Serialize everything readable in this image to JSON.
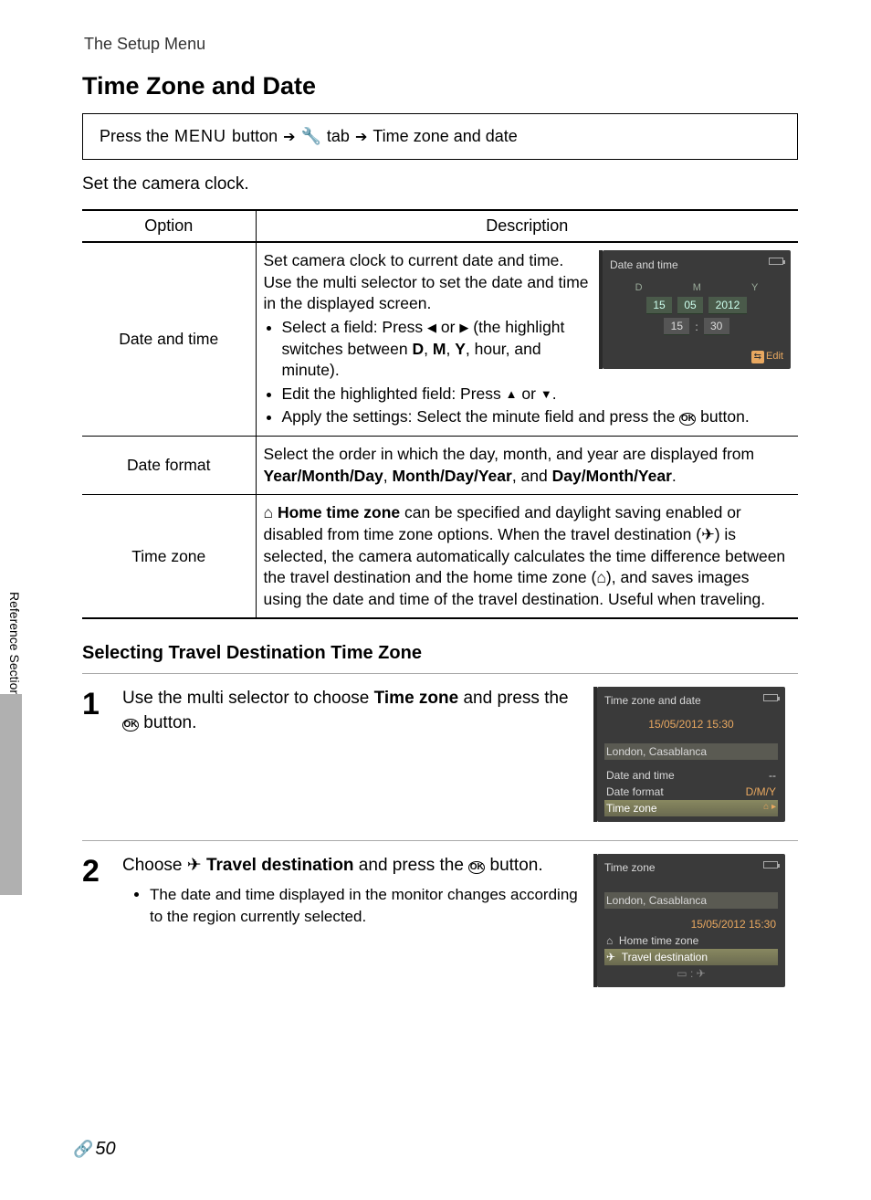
{
  "header": "The Setup Menu",
  "title": "Time Zone and Date",
  "nav": {
    "prefix": "Press the",
    "menu_word": "MENU",
    "button_word": "button",
    "tab_word": "tab",
    "dest": "Time zone and date"
  },
  "intro": "Set the camera clock.",
  "table": {
    "head_option": "Option",
    "head_desc": "Description",
    "rows": [
      {
        "option": "Date and time",
        "desc_pre": "Set camera clock to current date and time.\nUse the multi selector to set the date and time in the displayed screen.",
        "bullet1_a": "Select a field: Press ",
        "bullet1_b": " or ",
        "bullet1_c": " (the highlight switches between ",
        "bullet1_d": ", hour, and minute).",
        "bullet2_a": "Edit the highlighted field: Press ",
        "bullet2_b": " or ",
        "bullet2_c": ".",
        "bullet3_a": "Apply the settings: Select the minute field and press the ",
        "bullet3_b": " button.",
        "b_D": "D",
        "b_M": "M",
        "b_Y": "Y"
      },
      {
        "option": "Date format",
        "desc_a": "Select the order in which the day, month, and year are displayed from ",
        "b1": "Year/Month/Day",
        "s1": ", ",
        "b2": "Month/Day/Year",
        "s2": ", and ",
        "b3": "Day/Month/Year",
        "s3": "."
      },
      {
        "option": "Time zone",
        "b_home": "Home time zone",
        "desc_a": " can be specified and daylight saving enabled or disabled from time zone options. When the travel destination (",
        "desc_b": ") is selected, the camera automatically calculates the time difference between the travel destination and the home time zone (",
        "desc_c": "), and saves images using the date and time of the travel destination. Useful when traveling."
      }
    ]
  },
  "lcd_date": {
    "title": "Date and time",
    "D": "D",
    "M": "M",
    "Y": "Y",
    "d": "15",
    "m": "05",
    "y": "2012",
    "h": "15",
    "min": "30",
    "edit": "Edit"
  },
  "subheading": "Selecting Travel Destination Time Zone",
  "step1": {
    "num": "1",
    "a": "Use the multi selector to choose ",
    "b_tz": "Time zone",
    "b": " and press the ",
    "c": " button.",
    "lcd": {
      "title": "Time zone and date",
      "datetime": "15/05/2012 15:30",
      "zone": "London, Casablanca",
      "r1": "Date and time",
      "r1v": "--",
      "r2": "Date format",
      "r2v": "D/M/Y",
      "r3": "Time zone"
    }
  },
  "step2": {
    "num": "2",
    "a": "Choose ",
    "b_td": "Travel destination",
    "b": " and press the ",
    "c": " button.",
    "bullet": "The date and time displayed in the monitor changes according to the region currently selected.",
    "lcd": {
      "title": "Time zone",
      "zone": "London, Casablanca",
      "datetime": "15/05/2012 15:30",
      "r1": "Home time zone",
      "r2": "Travel destination"
    }
  },
  "side_label": "Reference Section",
  "footer_page": "50"
}
